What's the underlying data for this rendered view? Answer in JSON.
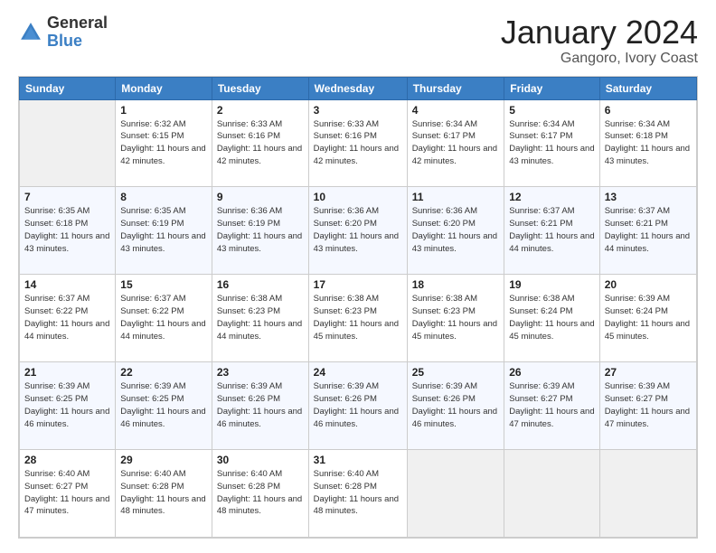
{
  "header": {
    "logo": {
      "general": "General",
      "blue": "Blue"
    },
    "title": "January 2024",
    "location": "Gangoro, Ivory Coast"
  },
  "calendar": {
    "days_of_week": [
      "Sunday",
      "Monday",
      "Tuesday",
      "Wednesday",
      "Thursday",
      "Friday",
      "Saturday"
    ],
    "weeks": [
      [
        {
          "day": "",
          "sunrise": "",
          "sunset": "",
          "daylight": "",
          "empty": true
        },
        {
          "day": "1",
          "sunrise": "Sunrise: 6:32 AM",
          "sunset": "Sunset: 6:15 PM",
          "daylight": "Daylight: 11 hours and 42 minutes."
        },
        {
          "day": "2",
          "sunrise": "Sunrise: 6:33 AM",
          "sunset": "Sunset: 6:16 PM",
          "daylight": "Daylight: 11 hours and 42 minutes."
        },
        {
          "day": "3",
          "sunrise": "Sunrise: 6:33 AM",
          "sunset": "Sunset: 6:16 PM",
          "daylight": "Daylight: 11 hours and 42 minutes."
        },
        {
          "day": "4",
          "sunrise": "Sunrise: 6:34 AM",
          "sunset": "Sunset: 6:17 PM",
          "daylight": "Daylight: 11 hours and 42 minutes."
        },
        {
          "day": "5",
          "sunrise": "Sunrise: 6:34 AM",
          "sunset": "Sunset: 6:17 PM",
          "daylight": "Daylight: 11 hours and 43 minutes."
        },
        {
          "day": "6",
          "sunrise": "Sunrise: 6:34 AM",
          "sunset": "Sunset: 6:18 PM",
          "daylight": "Daylight: 11 hours and 43 minutes."
        }
      ],
      [
        {
          "day": "7",
          "sunrise": "Sunrise: 6:35 AM",
          "sunset": "Sunset: 6:18 PM",
          "daylight": "Daylight: 11 hours and 43 minutes."
        },
        {
          "day": "8",
          "sunrise": "Sunrise: 6:35 AM",
          "sunset": "Sunset: 6:19 PM",
          "daylight": "Daylight: 11 hours and 43 minutes."
        },
        {
          "day": "9",
          "sunrise": "Sunrise: 6:36 AM",
          "sunset": "Sunset: 6:19 PM",
          "daylight": "Daylight: 11 hours and 43 minutes."
        },
        {
          "day": "10",
          "sunrise": "Sunrise: 6:36 AM",
          "sunset": "Sunset: 6:20 PM",
          "daylight": "Daylight: 11 hours and 43 minutes."
        },
        {
          "day": "11",
          "sunrise": "Sunrise: 6:36 AM",
          "sunset": "Sunset: 6:20 PM",
          "daylight": "Daylight: 11 hours and 43 minutes."
        },
        {
          "day": "12",
          "sunrise": "Sunrise: 6:37 AM",
          "sunset": "Sunset: 6:21 PM",
          "daylight": "Daylight: 11 hours and 44 minutes."
        },
        {
          "day": "13",
          "sunrise": "Sunrise: 6:37 AM",
          "sunset": "Sunset: 6:21 PM",
          "daylight": "Daylight: 11 hours and 44 minutes."
        }
      ],
      [
        {
          "day": "14",
          "sunrise": "Sunrise: 6:37 AM",
          "sunset": "Sunset: 6:22 PM",
          "daylight": "Daylight: 11 hours and 44 minutes."
        },
        {
          "day": "15",
          "sunrise": "Sunrise: 6:37 AM",
          "sunset": "Sunset: 6:22 PM",
          "daylight": "Daylight: 11 hours and 44 minutes."
        },
        {
          "day": "16",
          "sunrise": "Sunrise: 6:38 AM",
          "sunset": "Sunset: 6:23 PM",
          "daylight": "Daylight: 11 hours and 44 minutes."
        },
        {
          "day": "17",
          "sunrise": "Sunrise: 6:38 AM",
          "sunset": "Sunset: 6:23 PM",
          "daylight": "Daylight: 11 hours and 45 minutes."
        },
        {
          "day": "18",
          "sunrise": "Sunrise: 6:38 AM",
          "sunset": "Sunset: 6:23 PM",
          "daylight": "Daylight: 11 hours and 45 minutes."
        },
        {
          "day": "19",
          "sunrise": "Sunrise: 6:38 AM",
          "sunset": "Sunset: 6:24 PM",
          "daylight": "Daylight: 11 hours and 45 minutes."
        },
        {
          "day": "20",
          "sunrise": "Sunrise: 6:39 AM",
          "sunset": "Sunset: 6:24 PM",
          "daylight": "Daylight: 11 hours and 45 minutes."
        }
      ],
      [
        {
          "day": "21",
          "sunrise": "Sunrise: 6:39 AM",
          "sunset": "Sunset: 6:25 PM",
          "daylight": "Daylight: 11 hours and 46 minutes."
        },
        {
          "day": "22",
          "sunrise": "Sunrise: 6:39 AM",
          "sunset": "Sunset: 6:25 PM",
          "daylight": "Daylight: 11 hours and 46 minutes."
        },
        {
          "day": "23",
          "sunrise": "Sunrise: 6:39 AM",
          "sunset": "Sunset: 6:26 PM",
          "daylight": "Daylight: 11 hours and 46 minutes."
        },
        {
          "day": "24",
          "sunrise": "Sunrise: 6:39 AM",
          "sunset": "Sunset: 6:26 PM",
          "daylight": "Daylight: 11 hours and 46 minutes."
        },
        {
          "day": "25",
          "sunrise": "Sunrise: 6:39 AM",
          "sunset": "Sunset: 6:26 PM",
          "daylight": "Daylight: 11 hours and 46 minutes."
        },
        {
          "day": "26",
          "sunrise": "Sunrise: 6:39 AM",
          "sunset": "Sunset: 6:27 PM",
          "daylight": "Daylight: 11 hours and 47 minutes."
        },
        {
          "day": "27",
          "sunrise": "Sunrise: 6:39 AM",
          "sunset": "Sunset: 6:27 PM",
          "daylight": "Daylight: 11 hours and 47 minutes."
        }
      ],
      [
        {
          "day": "28",
          "sunrise": "Sunrise: 6:40 AM",
          "sunset": "Sunset: 6:27 PM",
          "daylight": "Daylight: 11 hours and 47 minutes."
        },
        {
          "day": "29",
          "sunrise": "Sunrise: 6:40 AM",
          "sunset": "Sunset: 6:28 PM",
          "daylight": "Daylight: 11 hours and 48 minutes."
        },
        {
          "day": "30",
          "sunrise": "Sunrise: 6:40 AM",
          "sunset": "Sunset: 6:28 PM",
          "daylight": "Daylight: 11 hours and 48 minutes."
        },
        {
          "day": "31",
          "sunrise": "Sunrise: 6:40 AM",
          "sunset": "Sunset: 6:28 PM",
          "daylight": "Daylight: 11 hours and 48 minutes."
        },
        {
          "day": "",
          "sunrise": "",
          "sunset": "",
          "daylight": "",
          "empty": true
        },
        {
          "day": "",
          "sunrise": "",
          "sunset": "",
          "daylight": "",
          "empty": true
        },
        {
          "day": "",
          "sunrise": "",
          "sunset": "",
          "daylight": "",
          "empty": true
        }
      ]
    ]
  }
}
